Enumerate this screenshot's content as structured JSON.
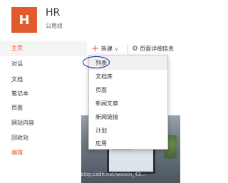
{
  "site": {
    "logo_letter": "H",
    "title": "HR",
    "subtitle": "公用组"
  },
  "nav": {
    "items": [
      {
        "label": "主页"
      },
      {
        "label": "对话"
      },
      {
        "label": "文档"
      },
      {
        "label": "笔记本"
      },
      {
        "label": "页面"
      },
      {
        "label": "网站内容"
      },
      {
        "label": "回收站"
      },
      {
        "label": "编辑"
      }
    ]
  },
  "command_bar": {
    "new_label": "新建",
    "details_label": "页面详细信息"
  },
  "new_menu": {
    "items": [
      {
        "label": "列表"
      },
      {
        "label": "文档库"
      },
      {
        "label": "页面"
      },
      {
        "label": "新闻文章"
      },
      {
        "label": "新闻链接"
      },
      {
        "label": "计划"
      },
      {
        "label": "应用"
      }
    ]
  },
  "watermark": "https://blog.csdn.net/weixin_43..."
}
